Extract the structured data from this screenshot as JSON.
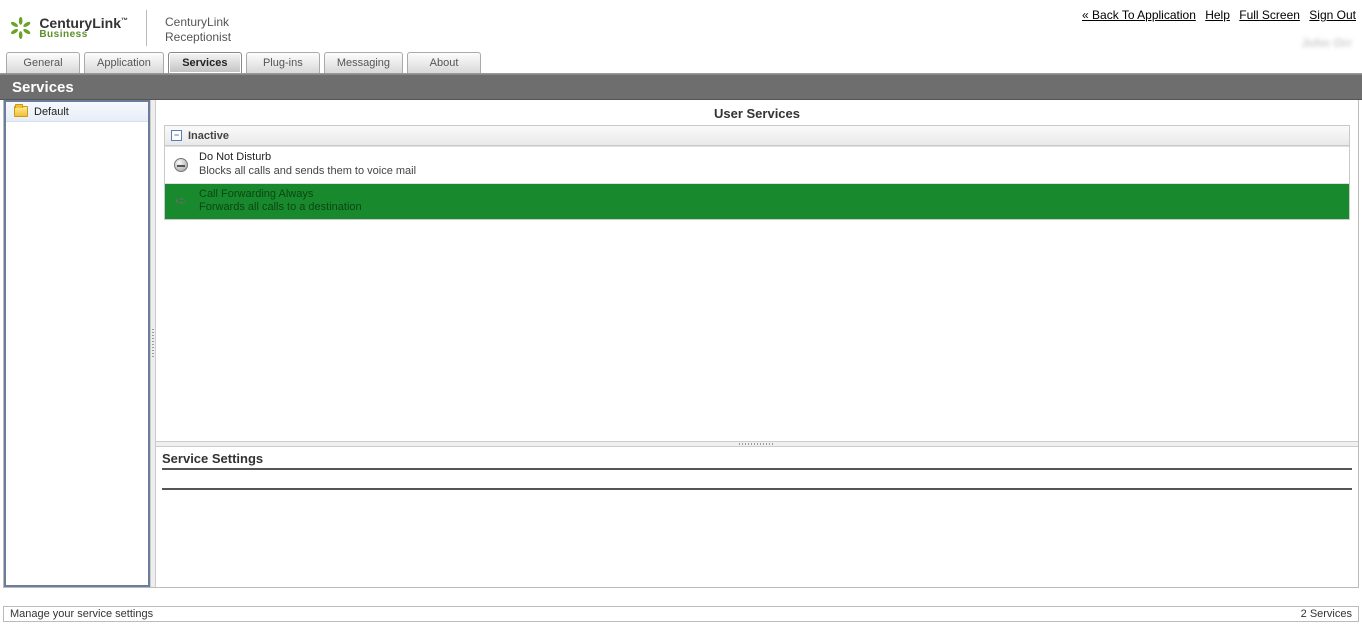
{
  "brand": {
    "name": "CenturyLink",
    "tm": "™",
    "sub": "Business"
  },
  "app": {
    "line1": "CenturyLink",
    "line2": "Receptionist"
  },
  "top_links": {
    "back": "« Back To Application",
    "help": "Help",
    "fullscreen": "Full Screen",
    "signout": "Sign Out"
  },
  "username_masked": "John Orr",
  "tabs": [
    {
      "id": "general",
      "label": "General",
      "active": false
    },
    {
      "id": "application",
      "label": "Application",
      "active": false
    },
    {
      "id": "services",
      "label": "Services",
      "active": true
    },
    {
      "id": "plugins",
      "label": "Plug-ins",
      "active": false
    },
    {
      "id": "messaging",
      "label": "Messaging",
      "active": false
    },
    {
      "id": "about",
      "label": "About",
      "active": false
    }
  ],
  "page_title": "Services",
  "sidebar": {
    "items": [
      {
        "label": "Default"
      }
    ]
  },
  "main": {
    "section_title": "User Services",
    "group_header": "Inactive",
    "collapse_symbol": "−",
    "services": [
      {
        "name": "Do Not Disturb",
        "desc": "Blocks all calls and sends them to voice mail",
        "icon": "dnd",
        "selected": false
      },
      {
        "name": "Call Forwarding Always",
        "desc": "Forwards all calls to a destination",
        "icon": "fwd",
        "selected": true
      }
    ],
    "settings_title": "Service Settings"
  },
  "status": {
    "left": "Manage your service settings",
    "right": "2 Services"
  }
}
